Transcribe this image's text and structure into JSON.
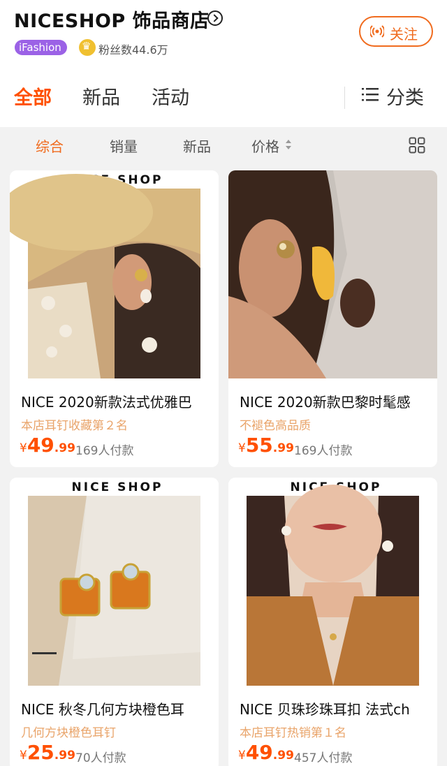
{
  "header": {
    "shop_name": "NICESHOP 饰品商店",
    "badge": "iFashion",
    "fans": "粉丝数44.6万",
    "follow_label": "关注"
  },
  "tabs": {
    "all": "全部",
    "new": "新品",
    "events": "活动",
    "category": "分类"
  },
  "sort": {
    "overall": "综合",
    "sales": "销量",
    "new": "新品",
    "price": "价格"
  },
  "products": [
    {
      "brand": "NICE SHOP",
      "name": "NICE 2020新款法式优雅巴",
      "tagline": "本店耳钉收藏第２名",
      "currency": "¥",
      "price_int": "49",
      "price_dec": ".99",
      "sold": "169人付款"
    },
    {
      "name": "NICE 2020新款巴黎时髦感",
      "tagline": "不褪色高品质",
      "currency": "¥",
      "price_int": "55",
      "price_dec": ".99",
      "sold": "169人付款"
    },
    {
      "brand": "NICE SHOP",
      "name": "NICE 秋冬几何方块橙色耳",
      "tagline": "几何方块橙色耳钉",
      "currency": "¥",
      "price_int": "25",
      "price_dec": ".99",
      "sold": "70人付款"
    },
    {
      "brand": "NICE SHOP",
      "name": "NICE 贝珠珍珠耳扣 法式ch",
      "tagline": "本店耳钉热销第１名",
      "currency": "¥",
      "price_int": "49",
      "price_dec": ".99",
      "sold": "457人付款"
    }
  ],
  "colors": {
    "accent": "#ff5000",
    "follow": "#f06b1e",
    "tagline": "#e9a46a",
    "badge": "#9b62e6"
  }
}
